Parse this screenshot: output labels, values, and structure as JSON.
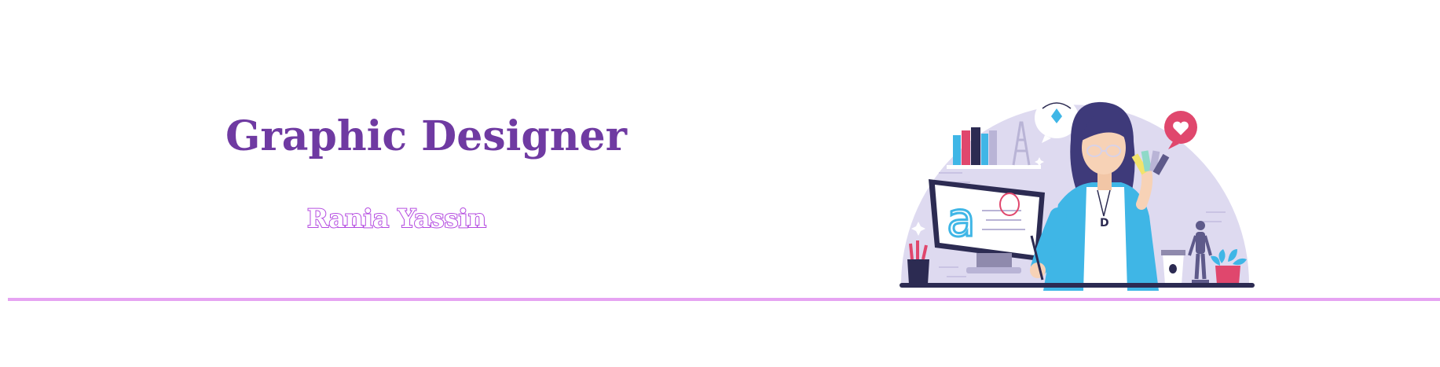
{
  "header": {
    "title": "Graphic Designer",
    "name": "Rania Yassin"
  },
  "colors": {
    "title": "#6f3aa2",
    "subtitle_outline": "#b44be0",
    "divider": "#e6a3f2",
    "illustration_bg": "#dedaf0",
    "jacket": "#3fb6e6"
  },
  "illustration": {
    "icon": "designer-at-desk-illustration",
    "monitor_letter": "a",
    "pendant_letter": "D"
  }
}
